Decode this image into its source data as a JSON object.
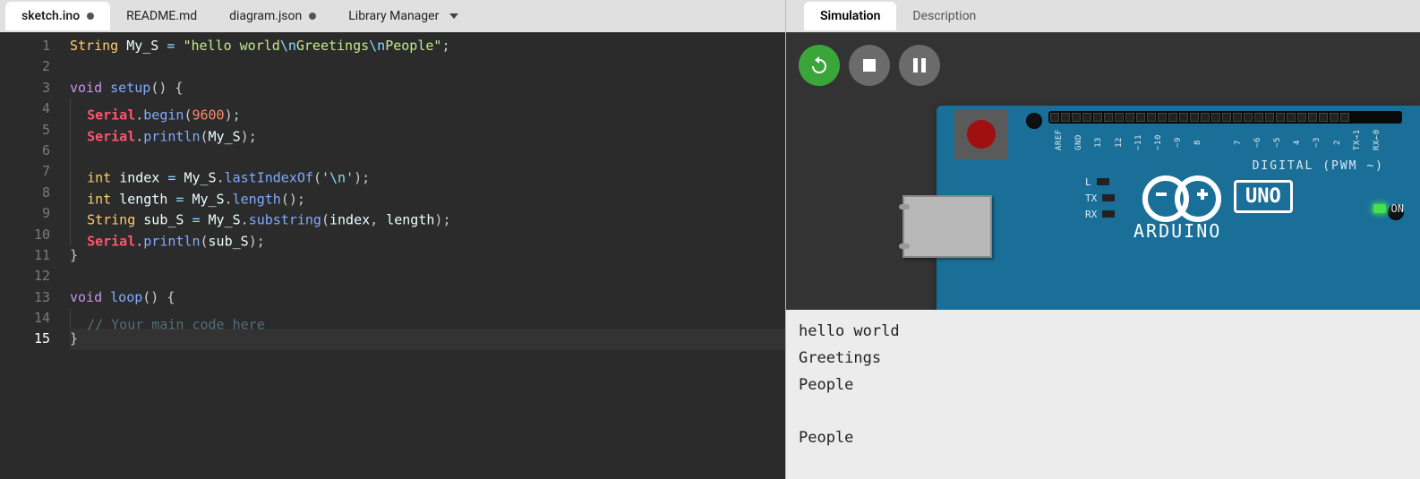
{
  "tabs": {
    "left": [
      {
        "label": "sketch.ino",
        "modified": true,
        "active": true
      },
      {
        "label": "README.md",
        "modified": false,
        "active": false
      },
      {
        "label": "diagram.json",
        "modified": true,
        "active": false
      },
      {
        "label": "Library Manager",
        "modified": false,
        "active": false,
        "dropdown": true
      }
    ],
    "right": [
      {
        "label": "Simulation",
        "active": true
      },
      {
        "label": "Description",
        "active": false
      }
    ]
  },
  "editor": {
    "current_line": 15,
    "lines": [
      {
        "n": 1,
        "tokens": [
          [
            "type",
            "String"
          ],
          [
            "",
            ", "
          ],
          [
            "id",
            "My_S"
          ],
          [
            "",
            ", "
          ],
          [
            "op",
            "="
          ],
          [
            "",
            ", "
          ],
          [
            "str",
            "\""
          ],
          [
            "str",
            "hello world"
          ],
          [
            "esc",
            "\\n"
          ],
          [
            "str",
            "Greetings"
          ],
          [
            "esc",
            "\\n"
          ],
          [
            "str",
            "People"
          ],
          [
            "str",
            "\""
          ],
          [
            "punc",
            ";"
          ]
        ]
      },
      {
        "n": 2,
        "tokens": []
      },
      {
        "n": 3,
        "tokens": [
          [
            "kw",
            "void"
          ],
          [
            "",
            ", "
          ],
          [
            "fn",
            "setup"
          ],
          [
            "punc",
            "()"
          ],
          [
            "",
            ", "
          ],
          [
            "punc",
            "{"
          ]
        ]
      },
      {
        "n": 4,
        "indent": 1,
        "tokens": [
          [
            "ser",
            "Serial"
          ],
          [
            "punc",
            "."
          ],
          [
            "fn",
            "begin"
          ],
          [
            "punc",
            "("
          ],
          [
            "num",
            "9600"
          ],
          [
            "punc",
            ")"
          ],
          [
            "punc",
            ";"
          ]
        ]
      },
      {
        "n": 5,
        "indent": 1,
        "tokens": [
          [
            "ser",
            "Serial"
          ],
          [
            "punc",
            "."
          ],
          [
            "fn",
            "println"
          ],
          [
            "punc",
            "("
          ],
          [
            "id",
            "My_S"
          ],
          [
            "punc",
            ")"
          ],
          [
            "punc",
            ";"
          ]
        ]
      },
      {
        "n": 6,
        "indent": 1,
        "tokens": []
      },
      {
        "n": 7,
        "indent": 1,
        "tokens": [
          [
            "type",
            "int"
          ],
          [
            "",
            ", "
          ],
          [
            "id",
            "index"
          ],
          [
            "",
            ", "
          ],
          [
            "op",
            "="
          ],
          [
            "",
            ", "
          ],
          [
            "id",
            "My_S"
          ],
          [
            "punc",
            "."
          ],
          [
            "fn",
            "lastIndexOf"
          ],
          [
            "punc",
            "("
          ],
          [
            "str",
            "'"
          ],
          [
            "esc",
            "\\n"
          ],
          [
            "str",
            "'"
          ],
          [
            "punc",
            ")"
          ],
          [
            "punc",
            ";"
          ]
        ]
      },
      {
        "n": 8,
        "indent": 1,
        "tokens": [
          [
            "type",
            "int"
          ],
          [
            "",
            ", "
          ],
          [
            "id",
            "length"
          ],
          [
            "",
            ", "
          ],
          [
            "op",
            "="
          ],
          [
            "",
            ", "
          ],
          [
            "id",
            "My_S"
          ],
          [
            "punc",
            "."
          ],
          [
            "fn",
            "length"
          ],
          [
            "punc",
            "()"
          ],
          [
            "punc",
            ";"
          ]
        ]
      },
      {
        "n": 9,
        "indent": 1,
        "tokens": [
          [
            "type",
            "String"
          ],
          [
            "",
            ", "
          ],
          [
            "id",
            "sub_S"
          ],
          [
            "",
            ", "
          ],
          [
            "op",
            "="
          ],
          [
            "",
            ", "
          ],
          [
            "id",
            "My_S"
          ],
          [
            "punc",
            "."
          ],
          [
            "fn",
            "substring"
          ],
          [
            "punc",
            "("
          ],
          [
            "id",
            "index"
          ],
          [
            "punc",
            ","
          ],
          [
            "",
            ", "
          ],
          [
            "id",
            "length"
          ],
          [
            "punc",
            ")"
          ],
          [
            "punc",
            ";"
          ]
        ]
      },
      {
        "n": 10,
        "indent": 1,
        "tokens": [
          [
            "ser",
            "Serial"
          ],
          [
            "punc",
            "."
          ],
          [
            "fn",
            "println"
          ],
          [
            "punc",
            "("
          ],
          [
            "id",
            "sub_S"
          ],
          [
            "punc",
            ")"
          ],
          [
            "punc",
            ";"
          ]
        ]
      },
      {
        "n": 11,
        "tokens": [
          [
            "punc",
            "}"
          ]
        ]
      },
      {
        "n": 12,
        "tokens": []
      },
      {
        "n": 13,
        "tokens": [
          [
            "kw",
            "void"
          ],
          [
            "",
            ", "
          ],
          [
            "fn",
            "loop"
          ],
          [
            "punc",
            "()"
          ],
          [
            "",
            ", "
          ],
          [
            "punc",
            "{"
          ]
        ]
      },
      {
        "n": 14,
        "indent": 1,
        "tokens": [
          [
            "cmt",
            "// Your main code here"
          ]
        ]
      },
      {
        "n": 15,
        "tokens": [
          [
            "punc",
            "}"
          ]
        ]
      }
    ]
  },
  "board": {
    "name": "ARDUINO",
    "model": "UNO",
    "digital_label": "DIGITAL (PWM ~)",
    "on_label": "ON",
    "side_leds": [
      "L",
      "TX",
      "RX"
    ],
    "top_pins": [
      "AREF",
      "GND",
      "13",
      "12",
      "~11",
      "~10",
      "~9",
      "8",
      "",
      "7",
      "~6",
      "~5",
      "4",
      "~3",
      "2",
      "TX→1",
      "RX←0"
    ]
  },
  "serial": {
    "lines": [
      "hello world",
      "Greetings",
      "People",
      "",
      "People"
    ]
  }
}
